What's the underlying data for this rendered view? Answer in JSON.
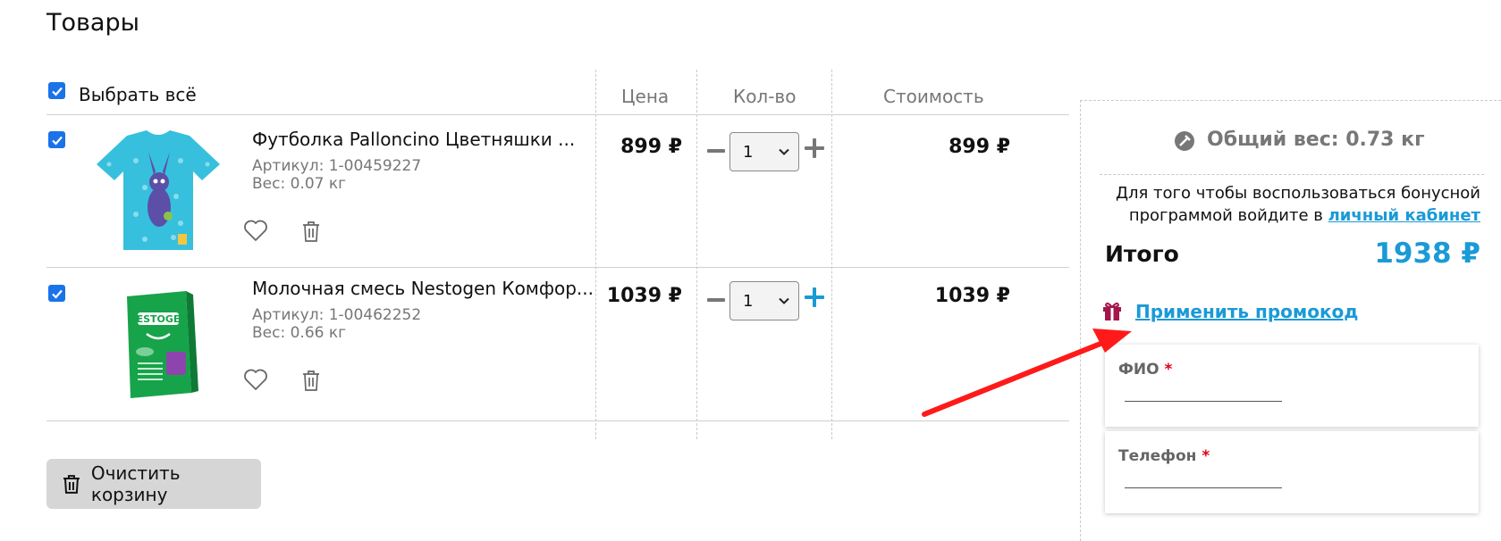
{
  "page": {
    "title": "Товары"
  },
  "table": {
    "select_all_label": "Выбрать всё",
    "headers": {
      "price": "Цена",
      "qty": "Кол-во",
      "cost": "Стоимость"
    }
  },
  "items": [
    {
      "name": "Футболка Palloncino Цветняшки ...",
      "sku": "Артикул: 1-00459227",
      "weight": "Вес: 0.07 кг",
      "price": "899 ₽",
      "qty": "1",
      "cost": "899 ₽",
      "checked": true
    },
    {
      "name": "Молочная смесь Nestogen Комфор...",
      "sku": "Артикул: 1-00462252",
      "weight": "Вес: 0.66 кг",
      "price": "1039 ₽",
      "qty": "1",
      "cost": "1039 ₽",
      "checked": true
    }
  ],
  "clear_cart_label": "Очистить корзину",
  "summary": {
    "weight_text": "Общий вес: 0.73 кг",
    "bonus_text": "Для того чтобы воспользоваться бонусной программой войдите в",
    "bonus_link": "личный кабинет",
    "total_label": "Итого",
    "total_value": "1938 ₽",
    "promo_link": "Применить промокод",
    "fields": [
      {
        "label": "ФИО",
        "required_mark": "*"
      },
      {
        "label": "Телефон",
        "required_mark": "*"
      }
    ]
  },
  "colors": {
    "accent": "#1a9ad6",
    "checkbox": "#1a73e8",
    "required": "#e0001b",
    "arrow": "#ff1a1a"
  }
}
